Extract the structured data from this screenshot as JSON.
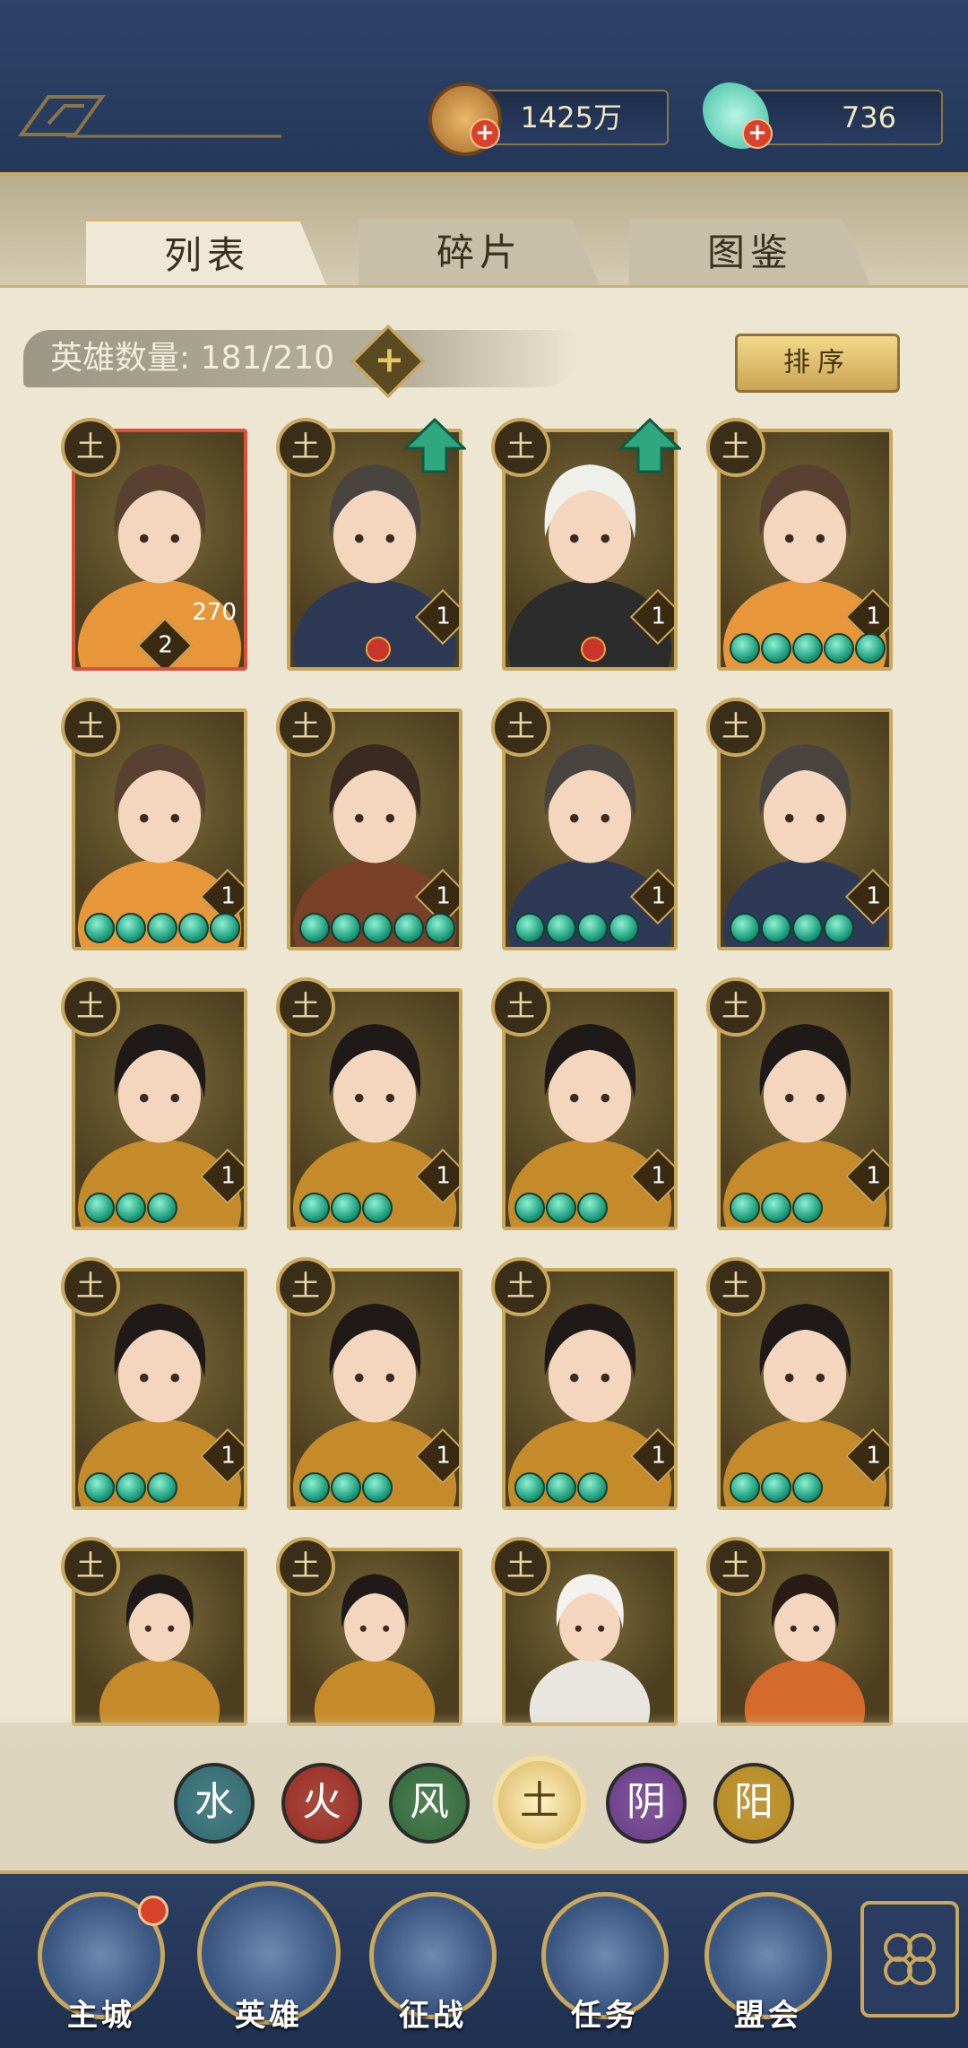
{
  "currency": {
    "coins": {
      "value": "1425万",
      "icon": "copper-coin-icon"
    },
    "jade": {
      "value": "736",
      "icon": "jade-shell-icon"
    }
  },
  "tabs": [
    {
      "label": "列表",
      "active": true
    },
    {
      "label": "碎片",
      "active": false
    },
    {
      "label": "图鉴",
      "active": false
    }
  ],
  "hero_count": {
    "label": "英雄数量: 181/210"
  },
  "sort_label": "排序",
  "element_symbol": "土",
  "heroes": [
    {
      "name": "hero-orange-youth",
      "stars": "2",
      "level": "270",
      "gems": 0,
      "upgrade": false,
      "tag": false,
      "highlight": true
    },
    {
      "name": "hero-ronin",
      "stars": "1",
      "gems": 0,
      "upgrade": true,
      "tag": true
    },
    {
      "name": "hero-white-hair",
      "stars": "1",
      "gems": 0,
      "upgrade": true,
      "tag": true
    },
    {
      "name": "hero-orange-youth",
      "stars": "1",
      "gems": 5
    },
    {
      "name": "hero-orange-youth",
      "stars": "1",
      "gems": 5
    },
    {
      "name": "hero-warlord",
      "stars": "1",
      "gems": 5
    },
    {
      "name": "hero-ronin",
      "stars": "1",
      "gems": 4
    },
    {
      "name": "hero-ronin",
      "stars": "1",
      "gems": 4
    },
    {
      "name": "hero-feather-lady",
      "stars": "1",
      "gems": 3
    },
    {
      "name": "hero-feather-lady",
      "stars": "1",
      "gems": 3
    },
    {
      "name": "hero-feather-lady",
      "stars": "1",
      "gems": 3
    },
    {
      "name": "hero-feather-lady",
      "stars": "1",
      "gems": 3
    },
    {
      "name": "hero-feather-lady",
      "stars": "1",
      "gems": 3
    },
    {
      "name": "hero-feather-lady",
      "stars": "1",
      "gems": 3
    },
    {
      "name": "hero-feather-lady",
      "stars": "1",
      "gems": 3
    },
    {
      "name": "hero-feather-lady",
      "stars": "1",
      "gems": 3
    },
    {
      "name": "hero-feather-lady",
      "stars": "",
      "gems": 0
    },
    {
      "name": "hero-feather-lady",
      "stars": "",
      "gems": 0
    },
    {
      "name": "hero-white-fur",
      "stars": "",
      "gems": 0
    },
    {
      "name": "hero-dancer",
      "stars": "",
      "gems": 0
    }
  ],
  "element_filters": [
    {
      "label": "水",
      "color": "#2c6b74"
    },
    {
      "label": "火",
      "color": "#9a2b22"
    },
    {
      "label": "风",
      "color": "#2f6a3a"
    },
    {
      "label": "土",
      "color": "#d7b45d",
      "selected": true
    },
    {
      "label": "阴",
      "color": "#6a3b8c"
    },
    {
      "label": "阳",
      "color": "#b88a1f"
    }
  ],
  "bottom_nav": [
    {
      "label": "主城",
      "icon": "city-gate-icon",
      "notify": true
    },
    {
      "label": "英雄",
      "icon": "hero-portrait-icon"
    },
    {
      "label": "征战",
      "icon": "battle-drum-icon"
    },
    {
      "label": "任务",
      "icon": "scroll-quest-icon"
    },
    {
      "label": "盟会",
      "icon": "guild-gate-icon"
    }
  ]
}
